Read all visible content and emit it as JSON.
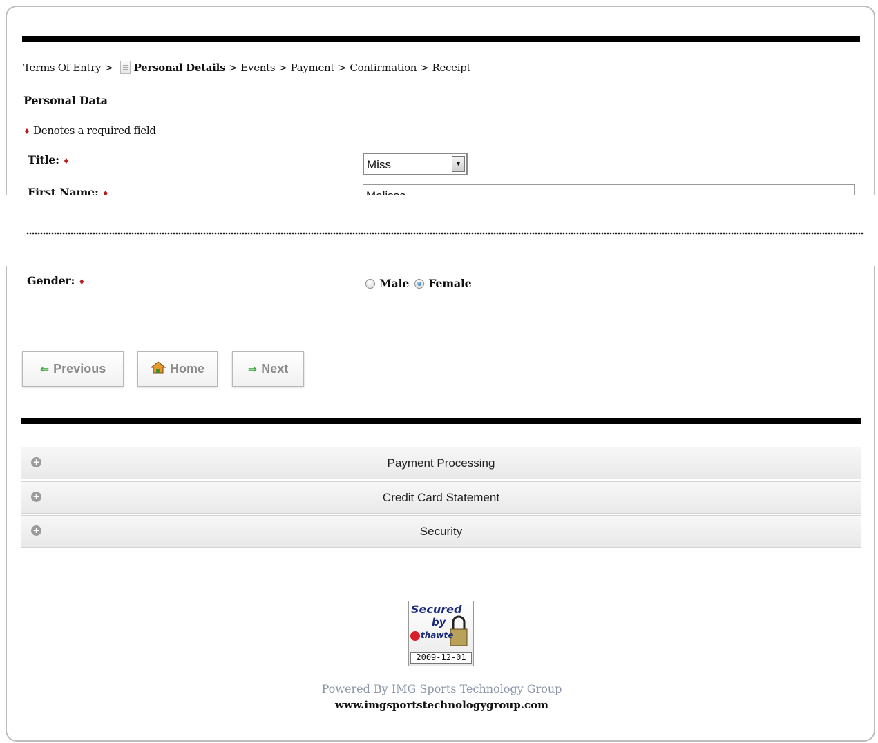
{
  "breadcrumb": {
    "items": [
      "Terms Of Entry",
      "Personal Details",
      "Events",
      "Payment",
      "Confirmation",
      "Receipt"
    ],
    "separator": ">",
    "active": "Personal Details"
  },
  "section_title": "Personal Data",
  "required_note": "Denotes a required field",
  "fields": {
    "title": {
      "label": "Title:",
      "value": "Miss"
    },
    "first_name": {
      "label": "First Name:",
      "value": "Melissa"
    },
    "gender": {
      "label": "Gender:",
      "options": [
        "Male",
        "Female"
      ],
      "selected": "Female"
    }
  },
  "buttons": {
    "previous": "Previous",
    "home": "Home",
    "next": "Next"
  },
  "accordion": [
    "Payment Processing",
    "Credit Card Statement",
    "Security"
  ],
  "badge": {
    "line1": "Secured",
    "line2": "by",
    "brand": "thawte",
    "date": "2009-12-01"
  },
  "footer": {
    "powered": "Powered By IMG Sports Technology Group",
    "site": "www.imgsportstechnologygroup.com"
  },
  "colors": {
    "required_dot": "#b71c1c",
    "bar": "#000000",
    "button_text": "#8a8a8a"
  }
}
